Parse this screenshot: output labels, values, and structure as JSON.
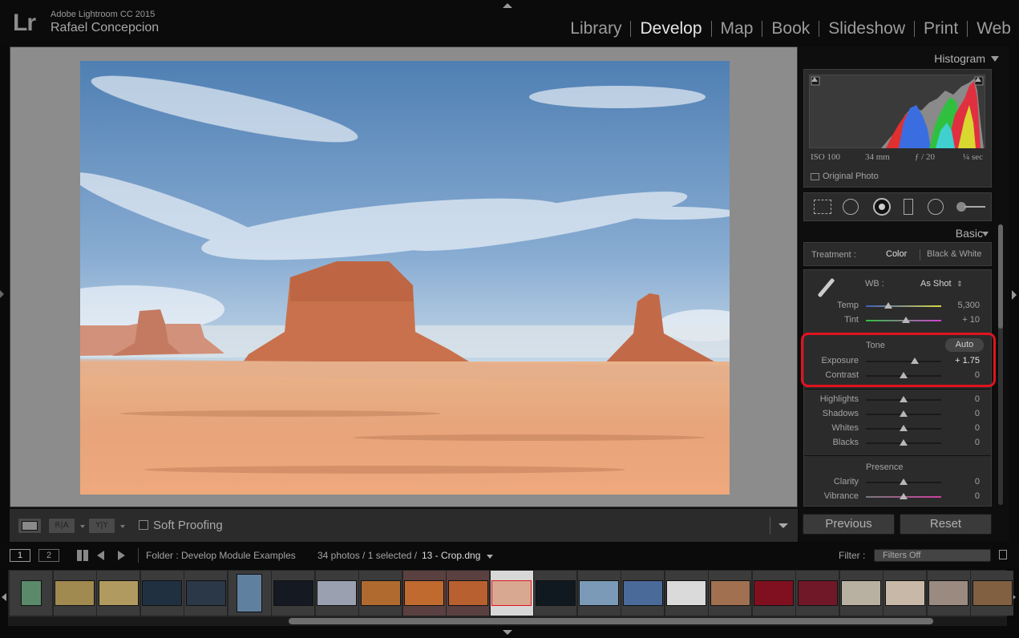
{
  "app": {
    "logo": "Lr",
    "name": "Adobe Lightroom CC 2015",
    "user": "Rafael Concepcion"
  },
  "modules": [
    "Library",
    "Develop",
    "Map",
    "Book",
    "Slideshow",
    "Print",
    "Web"
  ],
  "active_module": "Develop",
  "histogram": {
    "title": "Histogram",
    "iso": "ISO 100",
    "focal": "34 mm",
    "aperture": "ƒ / 20",
    "shutter": "¼ sec",
    "original_photo": "Original Photo"
  },
  "tools": [
    "crop-overlay-icon",
    "spot-removal-icon",
    "red-eye-icon",
    "graduated-filter-icon",
    "radial-filter-icon",
    "adjustment-brush-icon"
  ],
  "basic": {
    "title": "Basic",
    "treatment_label": "Treatment :",
    "treatment_color": "Color",
    "treatment_bw": "Black & White",
    "wb_label": "WB :",
    "wb_value": "As Shot",
    "temp": {
      "label": "Temp",
      "value": "5,300",
      "level": 0.3
    },
    "tint": {
      "label": "Tint",
      "value": "+ 10",
      "level": 0.53
    },
    "tone_label": "Tone",
    "auto_label": "Auto",
    "exposure": {
      "label": "Exposure",
      "value": "+ 1.75",
      "level": 0.65
    },
    "contrast": {
      "label": "Contrast",
      "value": "0",
      "level": 0.5
    },
    "highlights": {
      "label": "Highlights",
      "value": "0",
      "level": 0.5
    },
    "shadows": {
      "label": "Shadows",
      "value": "0",
      "level": 0.5
    },
    "whites": {
      "label": "Whites",
      "value": "0",
      "level": 0.5
    },
    "blacks": {
      "label": "Blacks",
      "value": "0",
      "level": 0.5
    },
    "presence_label": "Presence",
    "clarity": {
      "label": "Clarity",
      "value": "0",
      "level": 0.5
    },
    "vibrance": {
      "label": "Vibrance",
      "value": "0",
      "level": 0.5
    }
  },
  "buttons": {
    "previous": "Previous",
    "reset": "Reset"
  },
  "toolbar": {
    "soft_proofing": "Soft Proofing",
    "ra": "R|A",
    "yy": "Y|Y"
  },
  "filmbar": {
    "screen1": "1",
    "screen2": "2",
    "folder": "Folder : Develop Module Examples",
    "count": "34 photos / 1 selected /",
    "file": "13 - Crop.dng",
    "filter_label": "Filter :",
    "filter_value": "Filters Off"
  },
  "thumbs": [
    "#5a8a6a",
    "#a08a50",
    "#b09a60",
    "#203040",
    "#2a3848",
    "#6080a0",
    "#151a22",
    "#9aa0b0",
    "#b06a30",
    "#c06a30",
    "#b86030",
    "#d8a890",
    "#101820",
    "#7a9ab8",
    "#4a6a9a",
    "#dadada",
    "#a07050",
    "#801020",
    "#701828",
    "#b8b0a0",
    "#c8b8a8",
    "#9a8a80",
    "#806040"
  ],
  "selected_thumb": 11,
  "colors": {
    "accent_red": "#e0141e",
    "panel_bg": "#2b2b2b",
    "viewer_bg": "#8c8c8c"
  }
}
